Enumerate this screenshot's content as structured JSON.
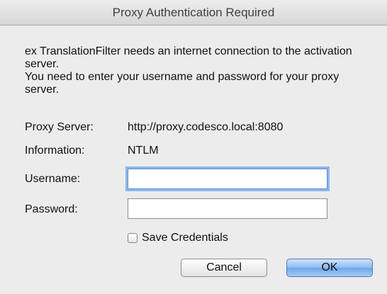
{
  "dialog": {
    "title": "Proxy Authentication Required",
    "message_line1": "ex TranslationFilter needs an internet connection to the activation server.",
    "message_line2": "You need to enter your username and password for your proxy server."
  },
  "fields": {
    "proxy_server_label": "Proxy Server:",
    "proxy_server_value": "http://proxy.codesco.local:8080",
    "information_label": "Information:",
    "information_value": "NTLM",
    "username_label": "Username:",
    "username_value": "",
    "password_label": "Password:",
    "password_value": ""
  },
  "save_credentials": {
    "label": "Save Credentials",
    "checked": false
  },
  "buttons": {
    "cancel": "Cancel",
    "ok": "OK"
  }
}
